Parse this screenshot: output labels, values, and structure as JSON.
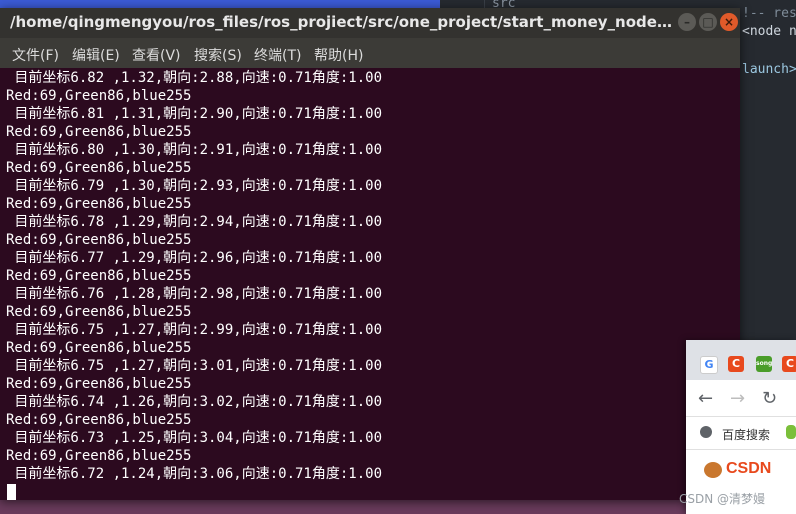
{
  "terminal": {
    "title": "/home/qingmengyou/ros_files/ros_projiect/src/one_project/start_money_node.launch http:...",
    "menu": [
      "文件(F)",
      "编辑(E)",
      "查看(V)",
      "搜索(S)",
      "终端(T)",
      "帮助(H)"
    ],
    "window_controls": {
      "minimize": "–",
      "maximize": "□",
      "close": "×"
    },
    "lines": [
      " 目前坐标6.82 ,1.32,朝向:2.88,向速:0.71角度:1.00",
      "Red:69,Green86,blue255",
      " 目前坐标6.81 ,1.31,朝向:2.90,向速:0.71角度:1.00",
      "Red:69,Green86,blue255",
      " 目前坐标6.80 ,1.30,朝向:2.91,向速:0.71角度:1.00",
      "Red:69,Green86,blue255",
      " 目前坐标6.79 ,1.30,朝向:2.93,向速:0.71角度:1.00",
      "Red:69,Green86,blue255",
      " 目前坐标6.78 ,1.29,朝向:2.94,向速:0.71角度:1.00",
      "Red:69,Green86,blue255",
      " 目前坐标6.77 ,1.29,朝向:2.96,向速:0.71角度:1.00",
      "Red:69,Green86,blue255",
      " 目前坐标6.76 ,1.28,朝向:2.98,向速:0.71角度:1.00",
      "Red:69,Green86,blue255",
      " 目前坐标6.75 ,1.27,朝向:2.99,向速:0.71角度:1.00",
      "Red:69,Green86,blue255",
      " 目前坐标6.75 ,1.27,朝向:3.01,向速:0.71角度:1.00",
      "Red:69,Green86,blue255",
      " 目前坐标6.74 ,1.26,朝向:3.02,向速:0.71角度:1.00",
      "Red:69,Green86,blue255",
      " 目前坐标6.73 ,1.25,朝向:3.04,向速:0.71角度:1.00",
      "Red:69,Green86,blue255",
      " 目前坐标6.72 ,1.24,朝向:3.06,向速:0.71角度:1.00"
    ]
  },
  "editor_background": {
    "line1": "!-- respa",
    "line2": "<node na",
    "line3": "launch>",
    "tab": "src"
  },
  "browser": {
    "tab_icons": [
      "G",
      "C",
      "song",
      "C"
    ],
    "nav": {
      "back": "←",
      "forward": "→",
      "reload": "↻"
    },
    "bookmark": "百度搜索",
    "logo": "CSDN"
  },
  "watermark": "CSDN @清梦嫚",
  "colors": {
    "terminal_bg": "#2c0a1f",
    "titlebar_bg": "#33322f",
    "menubar_bg": "#3c3b37",
    "close_button": "#e05a2a"
  }
}
